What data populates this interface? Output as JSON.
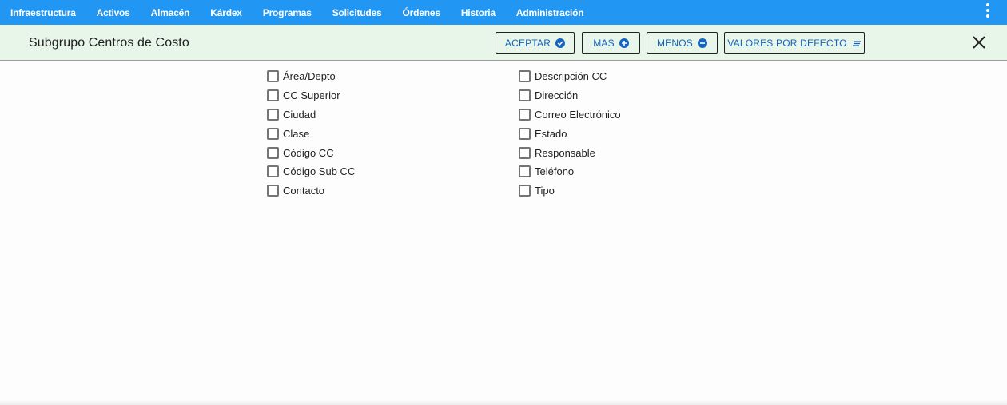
{
  "nav": {
    "items": [
      {
        "label": "Infraestructura"
      },
      {
        "label": "Activos"
      },
      {
        "label": "Almacén"
      },
      {
        "label": "Kárdex"
      },
      {
        "label": "Programas"
      },
      {
        "label": "Solicitudes"
      },
      {
        "label": "Órdenes"
      },
      {
        "label": "Historia"
      },
      {
        "label": "Administración"
      }
    ],
    "menu_icon": "more-vertical-icon"
  },
  "header": {
    "title": "Subgrupo Centros de Costo",
    "accept_label": "ACEPTAR",
    "more_label": "MAS",
    "less_label": "MENOS",
    "defaults_label": "VALORES POR DEFECTO",
    "close_icon": "close-icon"
  },
  "fields": {
    "left": [
      {
        "label": "Área/Depto",
        "checked": false
      },
      {
        "label": "CC Superior",
        "checked": false
      },
      {
        "label": "Ciudad",
        "checked": false
      },
      {
        "label": "Clase",
        "checked": false
      },
      {
        "label": "Código CC",
        "checked": false
      },
      {
        "label": "Código Sub CC",
        "checked": false
      },
      {
        "label": "Contacto",
        "checked": false
      }
    ],
    "right": [
      {
        "label": "Descripción CC",
        "checked": false
      },
      {
        "label": "Dirección",
        "checked": false
      },
      {
        "label": "Correo Electrónico",
        "checked": false
      },
      {
        "label": "Estado",
        "checked": false
      },
      {
        "label": "Responsable",
        "checked": false
      },
      {
        "label": "Teléfono",
        "checked": false
      },
      {
        "label": "Tipo",
        "checked": false
      }
    ]
  },
  "colors": {
    "nav_bg": "#2196f3",
    "subbar_bg": "#e8f5e9",
    "button_text": "#1565c0"
  }
}
